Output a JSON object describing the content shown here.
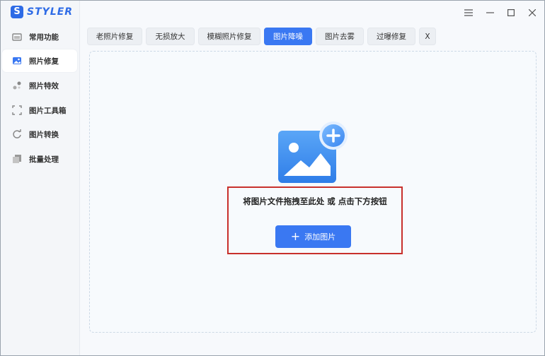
{
  "app": {
    "logo_letter": "S",
    "name": "STYLER"
  },
  "sidebar": {
    "items": [
      {
        "label": "常用功能",
        "icon": "common-icon"
      },
      {
        "label": "照片修复",
        "icon": "photo-repair-icon",
        "active": true
      },
      {
        "label": "照片特效",
        "icon": "effects-icon"
      },
      {
        "label": "图片工具箱",
        "icon": "toolbox-icon"
      },
      {
        "label": "图片转换",
        "icon": "convert-icon"
      },
      {
        "label": "批量处理",
        "icon": "batch-icon"
      }
    ]
  },
  "window_controls": {
    "menu": "☰",
    "minimize": "—",
    "maximize": "☐",
    "close": "✕"
  },
  "tabs": [
    {
      "label": "老照片修复"
    },
    {
      "label": "无损放大"
    },
    {
      "label": "模糊照片修复"
    },
    {
      "label": "图片降噪",
      "active": true
    },
    {
      "label": "图片去雾"
    },
    {
      "label": "过曝修复"
    },
    {
      "label": "X"
    }
  ],
  "main": {
    "drop_text": "将图片文件拖拽至此处 或 点击下方按钮",
    "add_button": {
      "icon": "+",
      "label": "添加图片"
    }
  },
  "colors": {
    "accent": "#3a78f2",
    "highlight": "#c8302c"
  }
}
